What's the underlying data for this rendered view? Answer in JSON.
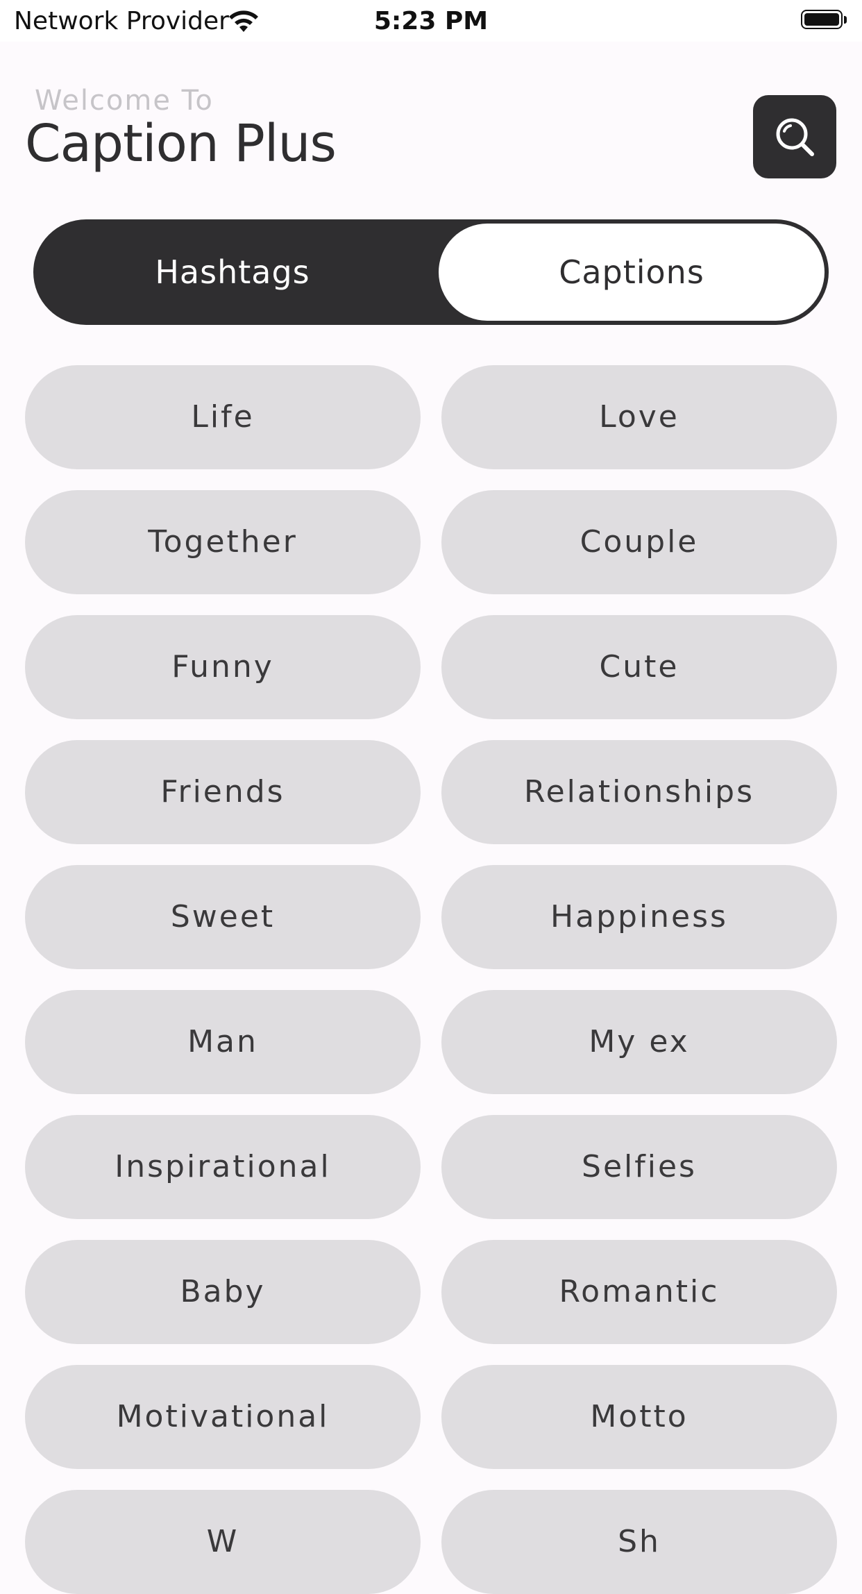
{
  "status_bar": {
    "carrier": "Network Provider",
    "time": "5:23 PM"
  },
  "header": {
    "welcome": "Welcome To",
    "title": "Caption Plus"
  },
  "tabs": [
    {
      "label": "Hashtags",
      "selected": false
    },
    {
      "label": "Captions",
      "selected": true
    }
  ],
  "categories": [
    "Life",
    "Love",
    "Together",
    "Couple",
    "Funny",
    "Cute",
    "Friends",
    "Relationships",
    "Sweet",
    "Happiness",
    "Man",
    "My ex",
    "Inspirational",
    "Selfies",
    "Baby",
    "Romantic",
    "Motivational",
    "Motto",
    "W",
    "Sh"
  ],
  "colors": {
    "background": "#fdfafd",
    "dark": "#2f2e30",
    "chip": "#dfdde0",
    "welcome_text": "#c6c4c8"
  }
}
